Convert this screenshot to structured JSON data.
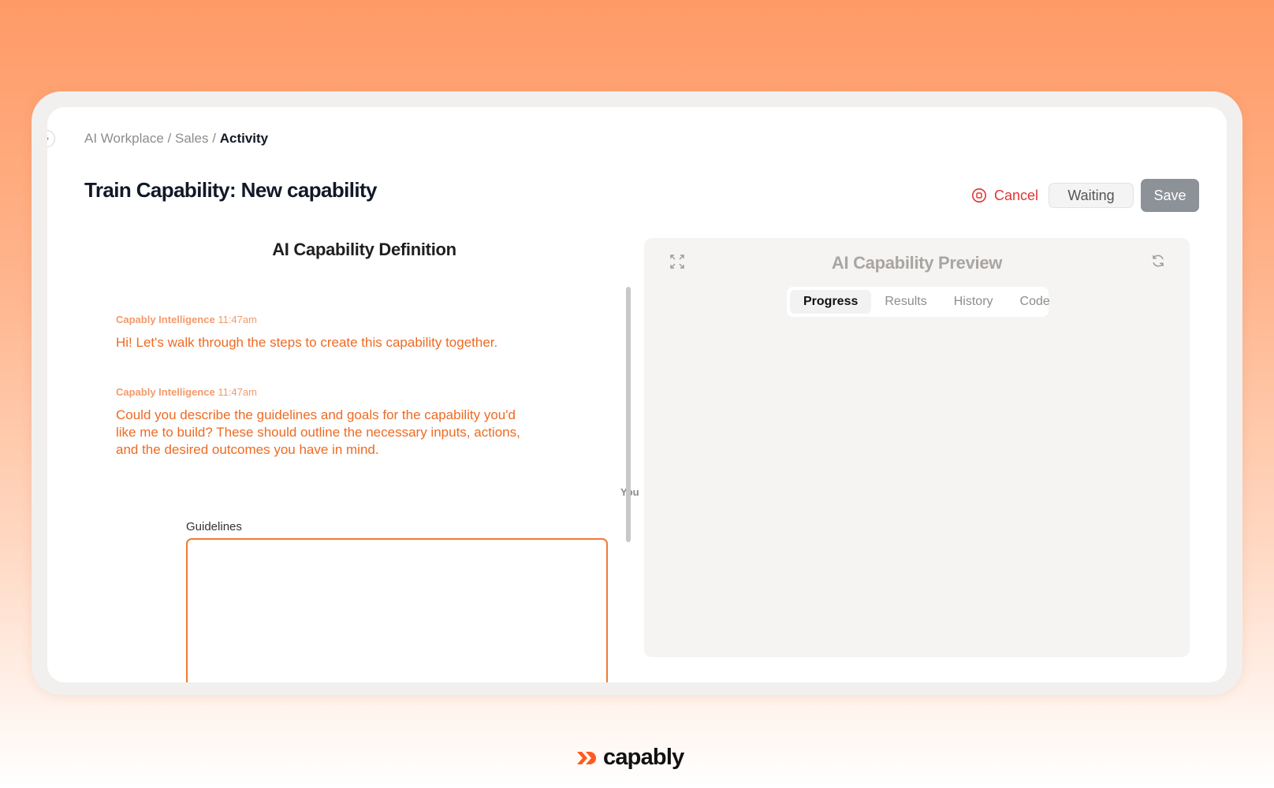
{
  "breadcrumb": {
    "items": [
      "AI Workplace",
      "Sales"
    ],
    "separator": "/",
    "current": "Activity"
  },
  "page": {
    "title": "Train Capability: New capability"
  },
  "actions": {
    "cancel": "Cancel",
    "status": "Waiting",
    "save": "Save"
  },
  "definition": {
    "title": "AI Capability Definition"
  },
  "chat": {
    "messages": [
      {
        "sender": "Capably Intelligence",
        "time": "11:47am",
        "text": "Hi! Let's walk through the steps to create this capability together."
      },
      {
        "sender": "Capably Intelligence",
        "time": "11:47am",
        "text": "Could you describe the guidelines and goals for the capability you'd like me to build? These should outline the necessary inputs, actions, and the desired outcomes you have in mind."
      }
    ],
    "you_label": "You",
    "guidelines": {
      "label": "Guidelines",
      "value": ""
    }
  },
  "preview": {
    "title": "AI Capability Preview",
    "tabs": [
      "Progress",
      "Results",
      "History",
      "Code"
    ],
    "active_tab": "Progress"
  },
  "brand": {
    "name": "capably",
    "accent": "#ff5a1f"
  },
  "icons": {
    "expand": "expand-icon",
    "refresh": "refresh-icon",
    "cancel": "stop-circle-icon",
    "collapse": "chevron-right-icon"
  }
}
